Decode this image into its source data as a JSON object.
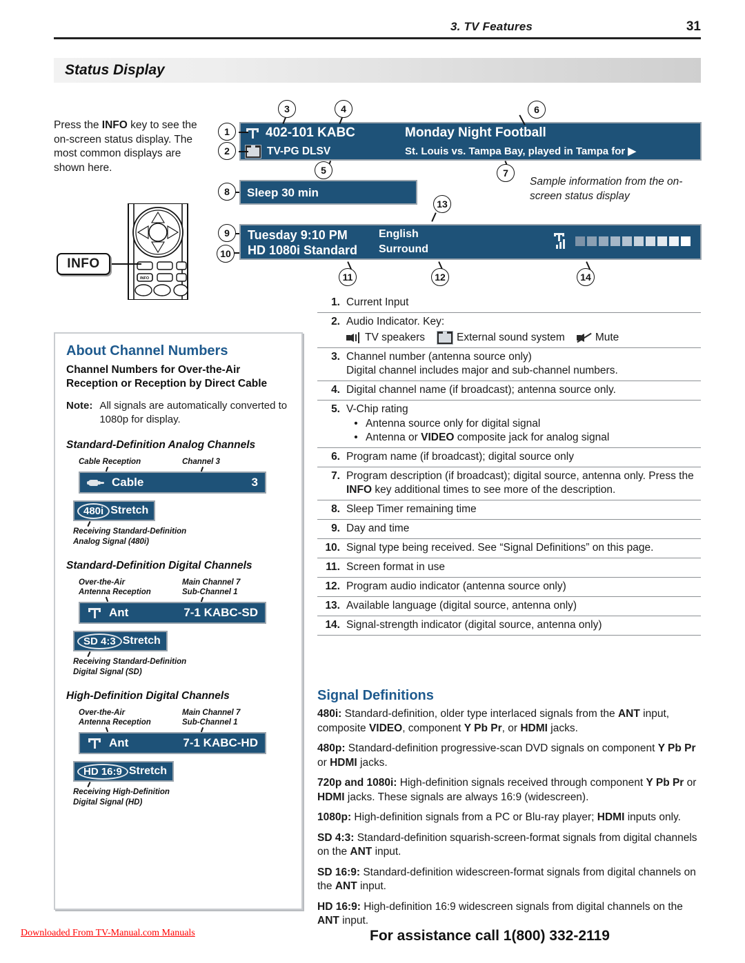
{
  "header": {
    "section": "3.  TV Features",
    "page": "31"
  },
  "banner": {
    "title": "Status Display"
  },
  "intro": {
    "before": "Press the ",
    "key": "INFO",
    "after": " key to see the on-screen status display.  The most common displays are shown here."
  },
  "remote": {
    "info_chip": "INFO"
  },
  "osd": {
    "channel": "402-101 KABC",
    "rating": "TV-PG DLSV",
    "program": "Monday Night Football",
    "description": "St. Louis vs. Tampa Bay, played in Tampa for ▶",
    "sleep": "Sleep 30 min",
    "daytime": "Tuesday 9:10 PM",
    "signaltype": "HD 1080i Standard",
    "language": "English",
    "audio": "Surround",
    "antenna_icon": "antenna-icon",
    "external_icon": "external-sound-system-icon",
    "signal_icon": "signal-strength-antenna-icon"
  },
  "callouts": [
    "1",
    "2",
    "3",
    "4",
    "5",
    "6",
    "7",
    "8",
    "9",
    "10",
    "11",
    "12",
    "13",
    "14"
  ],
  "sample_caption": "Sample information from the on-screen status display",
  "about_channel_numbers": {
    "title": "About Channel Numbers",
    "subtitle": "Channel Numbers for Over-the-Air Reception or Reception by Direct Cable",
    "note_label": "Note:",
    "note_text": "All signals are automatically converted to 1080p for display.",
    "groups": [
      {
        "heading": "Standard-Definition Analog Channels",
        "annot_left": "Cable Reception",
        "annot_right": "Channel 3",
        "source_icon": "cable-connector-icon",
        "source": "Cable",
        "number": "3",
        "format_badge": "480i",
        "format_label": "Stretch",
        "footnote": "Receiving Standard-Definition Analog Signal (480i)"
      },
      {
        "heading": "Standard-Definition Digital Channels",
        "annot_left": "Over-the-Air Antenna Reception",
        "annot_right": "Main Channel 7 Sub-Channel 1",
        "source_icon": "antenna-icon",
        "source": "Ant",
        "number": "7-1 KABC-SD",
        "format_badge": "SD 4:3",
        "format_label": "Stretch",
        "footnote": "Receiving Standard-Definition Digital Signal (SD)"
      },
      {
        "heading": "High-Definition Digital Channels",
        "annot_left": "Over-the-Air Antenna Reception",
        "annot_right": "Main Channel 7 Sub-Channel 1",
        "source_icon": "antenna-icon",
        "source": "Ant",
        "number": "7-1 KABC-HD",
        "format_badge": "HD 16:9",
        "format_label": "Stretch",
        "footnote": "Receiving High-Definition Digital Signal (HD)"
      }
    ]
  },
  "numbered_list": [
    {
      "n": "1.",
      "text": "Current Input"
    },
    {
      "n": "2.",
      "text": "Audio Indicator.  Key:",
      "key_items": [
        {
          "icon": "tv-speakers-icon",
          "label": "TV speakers"
        },
        {
          "icon": "external-sound-system-icon",
          "label": "External sound system"
        },
        {
          "icon": "mute-icon",
          "label": "Mute"
        }
      ]
    },
    {
      "n": "3.",
      "text": "Channel number (antenna source only)\nDigital channel includes major and sub-channel numbers."
    },
    {
      "n": "4.",
      "text": "Digital channel name (if broadcast); antenna source only."
    },
    {
      "n": "5.",
      "text": "V-Chip rating",
      "bullets": [
        "Antenna source only for digital signal",
        "Antenna or VIDEO composite jack for analog signal"
      ]
    },
    {
      "n": "6.",
      "text": "Program name (if broadcast); digital source only"
    },
    {
      "n": "7.",
      "text": "Program description (if broadcast); digital source, antenna only.  Press the INFO key additional times to see more of the description."
    },
    {
      "n": "8.",
      "text": "Sleep Timer remaining time"
    },
    {
      "n": "9.",
      "text": "Day and time"
    },
    {
      "n": "10.",
      "text": "Signal type being received.  See “Signal Definitions” on this page."
    },
    {
      "n": "11.",
      "text": "Screen format in use"
    },
    {
      "n": "12.",
      "text": "Program audio indicator (antenna source only)"
    },
    {
      "n": "13.",
      "text": "Available language (digital source, antenna only)"
    },
    {
      "n": "14.",
      "text": "Signal-strength indicator (digital source, antenna only)"
    }
  ],
  "signal_definitions": {
    "title": "Signal Definitions",
    "entries": [
      {
        "term": "480i:",
        "text": " Standard-definition, older type interlaced signals from the ANT input, composite VIDEO, component Y Pb Pr, or HDMI jacks."
      },
      {
        "term": "480p:",
        "text": " Standard-definition progressive-scan DVD signals on component Y Pb Pr or HDMI jacks."
      },
      {
        "term": "720p and 1080i:",
        "text": " High-definition signals received through component Y Pb Pr or HDMI jacks.  These signals are always 16:9 (widescreen)."
      },
      {
        "term": "1080p:",
        "text": " High-definition signals from a PC or Blu-ray player; HDMI inputs only."
      },
      {
        "term": "SD 4:3:",
        "text": " Standard-definition squarish-screen-format signals from digital channels on the ANT input."
      },
      {
        "term": "SD 16:9:",
        "text": " Standard-definition widescreen-format signals from digital channels on the ANT input."
      },
      {
        "term": "HD 16:9:",
        "text": " High-definition 16:9 widescreen signals from digital channels on the ANT input."
      }
    ]
  },
  "footer": {
    "download_link": "Downloaded From TV-Manual.com Manuals",
    "assistance": "For assistance call 1(800) 332-2119"
  },
  "colors": {
    "osd_blue": "#1e5278",
    "heading_blue": "#1e5a8e",
    "link_red": "#ff0000"
  }
}
